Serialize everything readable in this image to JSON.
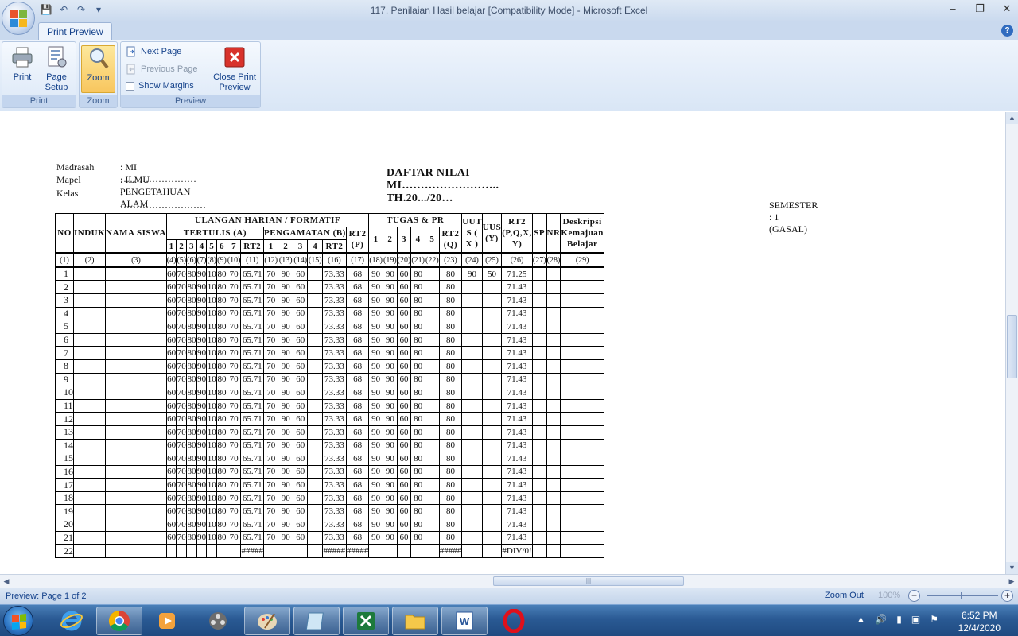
{
  "window": {
    "title": "117. Penilaian Hasil  belajar  [Compatibility Mode] - Microsoft Excel",
    "minimize": "–",
    "restore": "❐",
    "close": "✕"
  },
  "qat": {
    "save": "💾",
    "undo": "↶",
    "redo": "↷",
    "customize": "▾"
  },
  "ribbon": {
    "active_tab": "Print Preview",
    "help": "?",
    "groups": {
      "print": {
        "label": "Print",
        "print_btn": "Print",
        "page_setup_btn_line1": "Page",
        "page_setup_btn_line2": "Setup"
      },
      "zoom": {
        "label": "Zoom",
        "zoom_btn": "Zoom"
      },
      "preview": {
        "label": "Preview",
        "next_page": "Next Page",
        "previous_page": "Previous Page",
        "show_margins": "Show Margins",
        "close_line1": "Close Print",
        "close_line2": "Preview"
      }
    }
  },
  "document": {
    "header": {
      "madrasah_label": "Madrasah",
      "madrasah_value": ": MI ……………………",
      "mapel_label": "Mapel",
      "mapel_value": ": ILMU PENGETAHUAN ALAM",
      "kelas_label": "Kelas",
      "kelas_value": ": ………………………"
    },
    "title": "DAFTAR NILAI MI…………………….. TH.20.../20…",
    "semester": "SEMESTER   : 1 (GASAL)",
    "table": {
      "h_no": "NO",
      "h_induk": "INDUK",
      "h_nama": "NAMA SISWA",
      "h_ulangan": "ULANGAN HARIAN / FORMATIF",
      "h_tugas": "TUGAS & PR",
      "h_uuts": "UUT S ( X )",
      "h_uus": "UUS (Y)",
      "h_rt2all": "RT2 (P,Q,X, Y)",
      "h_sp": "SP",
      "h_nr": "NR",
      "h_desk": "Deskripsi Kemajuan Belajar",
      "h_tertulis": "TERTULIS (A)",
      "h_pengamatan": "PENGAMATAN (B)",
      "h_rt2p": "RT2 (P)",
      "h_rt2q": "RT2 (Q)",
      "sub_tertulis": [
        "1",
        "2",
        "3",
        "4",
        "5",
        "6",
        "7",
        "RT2"
      ],
      "sub_pengamatan": [
        "1",
        "2",
        "3",
        "4",
        "RT2"
      ],
      "sub_tugas": [
        "1",
        "2",
        "3",
        "4",
        "5"
      ],
      "col_numbers": [
        "(1)",
        "(2)",
        "(3)",
        "(4)",
        "(5)",
        "(6)",
        "(7)",
        "(8)",
        "(9)",
        "(10)",
        "(11)",
        "(12)",
        "(13)",
        "(14)",
        "(15)",
        "(16)",
        "(17)",
        "(18)",
        "(19)",
        "(20)",
        "(21)",
        "(22)",
        "(23)",
        "(24)",
        "(25)",
        "(26)",
        "(27)",
        "(28)",
        "(29)"
      ],
      "rows": [
        [
          "1",
          "",
          "",
          "60",
          "70",
          "80",
          "90",
          "10",
          "80",
          "70",
          "65.71",
          "70",
          "90",
          "60",
          "",
          "73.33",
          "68",
          "90",
          "90",
          "60",
          "80",
          "",
          "80",
          "90",
          "50",
          "71.25",
          "",
          "",
          ""
        ],
        [
          "2",
          "",
          "",
          "60",
          "70",
          "80",
          "90",
          "10",
          "80",
          "70",
          "65.71",
          "70",
          "90",
          "60",
          "",
          "73.33",
          "68",
          "90",
          "90",
          "60",
          "80",
          "",
          "80",
          "",
          "",
          "71.43",
          "",
          "",
          ""
        ],
        [
          "3",
          "",
          "",
          "60",
          "70",
          "80",
          "90",
          "10",
          "80",
          "70",
          "65.71",
          "70",
          "90",
          "60",
          "",
          "73.33",
          "68",
          "90",
          "90",
          "60",
          "80",
          "",
          "80",
          "",
          "",
          "71.43",
          "",
          "",
          ""
        ],
        [
          "4",
          "",
          "",
          "60",
          "70",
          "80",
          "90",
          "10",
          "80",
          "70",
          "65.71",
          "70",
          "90",
          "60",
          "",
          "73.33",
          "68",
          "90",
          "90",
          "60",
          "80",
          "",
          "80",
          "",
          "",
          "71.43",
          "",
          "",
          ""
        ],
        [
          "5",
          "",
          "",
          "60",
          "70",
          "80",
          "90",
          "10",
          "80",
          "70",
          "65.71",
          "70",
          "90",
          "60",
          "",
          "73.33",
          "68",
          "90",
          "90",
          "60",
          "80",
          "",
          "80",
          "",
          "",
          "71.43",
          "",
          "",
          ""
        ],
        [
          "6",
          "",
          "",
          "60",
          "70",
          "80",
          "90",
          "10",
          "80",
          "70",
          "65.71",
          "70",
          "90",
          "60",
          "",
          "73.33",
          "68",
          "90",
          "90",
          "60",
          "80",
          "",
          "80",
          "",
          "",
          "71.43",
          "",
          "",
          ""
        ],
        [
          "7",
          "",
          "",
          "60",
          "70",
          "80",
          "90",
          "10",
          "80",
          "70",
          "65.71",
          "70",
          "90",
          "60",
          "",
          "73.33",
          "68",
          "90",
          "90",
          "60",
          "80",
          "",
          "80",
          "",
          "",
          "71.43",
          "",
          "",
          ""
        ],
        [
          "8",
          "",
          "",
          "60",
          "70",
          "80",
          "90",
          "10",
          "80",
          "70",
          "65.71",
          "70",
          "90",
          "60",
          "",
          "73.33",
          "68",
          "90",
          "90",
          "60",
          "80",
          "",
          "80",
          "",
          "",
          "71.43",
          "",
          "",
          ""
        ],
        [
          "9",
          "",
          "",
          "60",
          "70",
          "80",
          "90",
          "10",
          "80",
          "70",
          "65.71",
          "70",
          "90",
          "60",
          "",
          "73.33",
          "68",
          "90",
          "90",
          "60",
          "80",
          "",
          "80",
          "",
          "",
          "71.43",
          "",
          "",
          ""
        ],
        [
          "10",
          "",
          "",
          "60",
          "70",
          "80",
          "90",
          "10",
          "80",
          "70",
          "65.71",
          "70",
          "90",
          "60",
          "",
          "73.33",
          "68",
          "90",
          "90",
          "60",
          "80",
          "",
          "80",
          "",
          "",
          "71.43",
          "",
          "",
          ""
        ],
        [
          "11",
          "",
          "",
          "60",
          "70",
          "80",
          "90",
          "10",
          "80",
          "70",
          "65.71",
          "70",
          "90",
          "60",
          "",
          "73.33",
          "68",
          "90",
          "90",
          "60",
          "80",
          "",
          "80",
          "",
          "",
          "71.43",
          "",
          "",
          ""
        ],
        [
          "12",
          "",
          "",
          "60",
          "70",
          "80",
          "90",
          "10",
          "80",
          "70",
          "65.71",
          "70",
          "90",
          "60",
          "",
          "73.33",
          "68",
          "90",
          "90",
          "60",
          "80",
          "",
          "80",
          "",
          "",
          "71.43",
          "",
          "",
          ""
        ],
        [
          "13",
          "",
          "",
          "60",
          "70",
          "80",
          "90",
          "10",
          "80",
          "70",
          "65.71",
          "70",
          "90",
          "60",
          "",
          "73.33",
          "68",
          "90",
          "90",
          "60",
          "80",
          "",
          "80",
          "",
          "",
          "71.43",
          "",
          "",
          ""
        ],
        [
          "14",
          "",
          "",
          "60",
          "70",
          "80",
          "90",
          "10",
          "80",
          "70",
          "65.71",
          "70",
          "90",
          "60",
          "",
          "73.33",
          "68",
          "90",
          "90",
          "60",
          "80",
          "",
          "80",
          "",
          "",
          "71.43",
          "",
          "",
          ""
        ],
        [
          "15",
          "",
          "",
          "60",
          "70",
          "80",
          "90",
          "10",
          "80",
          "70",
          "65.71",
          "70",
          "90",
          "60",
          "",
          "73.33",
          "68",
          "90",
          "90",
          "60",
          "80",
          "",
          "80",
          "",
          "",
          "71.43",
          "",
          "",
          ""
        ],
        [
          "16",
          "",
          "",
          "60",
          "70",
          "80",
          "90",
          "10",
          "80",
          "70",
          "65.71",
          "70",
          "90",
          "60",
          "",
          "73.33",
          "68",
          "90",
          "90",
          "60",
          "80",
          "",
          "80",
          "",
          "",
          "71.43",
          "",
          "",
          ""
        ],
        [
          "17",
          "",
          "",
          "60",
          "70",
          "80",
          "90",
          "10",
          "80",
          "70",
          "65.71",
          "70",
          "90",
          "60",
          "",
          "73.33",
          "68",
          "90",
          "90",
          "60",
          "80",
          "",
          "80",
          "",
          "",
          "71.43",
          "",
          "",
          ""
        ],
        [
          "18",
          "",
          "",
          "60",
          "70",
          "80",
          "90",
          "10",
          "80",
          "70",
          "65.71",
          "70",
          "90",
          "60",
          "",
          "73.33",
          "68",
          "90",
          "90",
          "60",
          "80",
          "",
          "80",
          "",
          "",
          "71.43",
          "",
          "",
          ""
        ],
        [
          "19",
          "",
          "",
          "60",
          "70",
          "80",
          "90",
          "10",
          "80",
          "70",
          "65.71",
          "70",
          "90",
          "60",
          "",
          "73.33",
          "68",
          "90",
          "90",
          "60",
          "80",
          "",
          "80",
          "",
          "",
          "71.43",
          "",
          "",
          ""
        ],
        [
          "20",
          "",
          "",
          "60",
          "70",
          "80",
          "90",
          "10",
          "80",
          "70",
          "65.71",
          "70",
          "90",
          "60",
          "",
          "73.33",
          "68",
          "90",
          "90",
          "60",
          "80",
          "",
          "80",
          "",
          "",
          "71.43",
          "",
          "",
          ""
        ],
        [
          "21",
          "",
          "",
          "60",
          "70",
          "80",
          "90",
          "10",
          "80",
          "70",
          "65.71",
          "70",
          "90",
          "60",
          "",
          "73.33",
          "68",
          "90",
          "90",
          "60",
          "80",
          "",
          "80",
          "",
          "",
          "71.43",
          "",
          "",
          ""
        ],
        [
          "22",
          "",
          "",
          "",
          "",
          "",
          "",
          "",
          "",
          "",
          "#####",
          "",
          "",
          "",
          "",
          "#####",
          "#####",
          "",
          "",
          "",
          "",
          "",
          "#####",
          "",
          "",
          "#DIV/0!",
          "",
          "",
          ""
        ]
      ]
    }
  },
  "statusbar": {
    "page_info": "Preview: Page 1 of 2",
    "zoom_out": "Zoom Out",
    "zoom_pct": "100%",
    "minus": "−",
    "plus": "+"
  },
  "taskbar": {
    "time": "6:52 PM",
    "date": "12/4/2020"
  }
}
